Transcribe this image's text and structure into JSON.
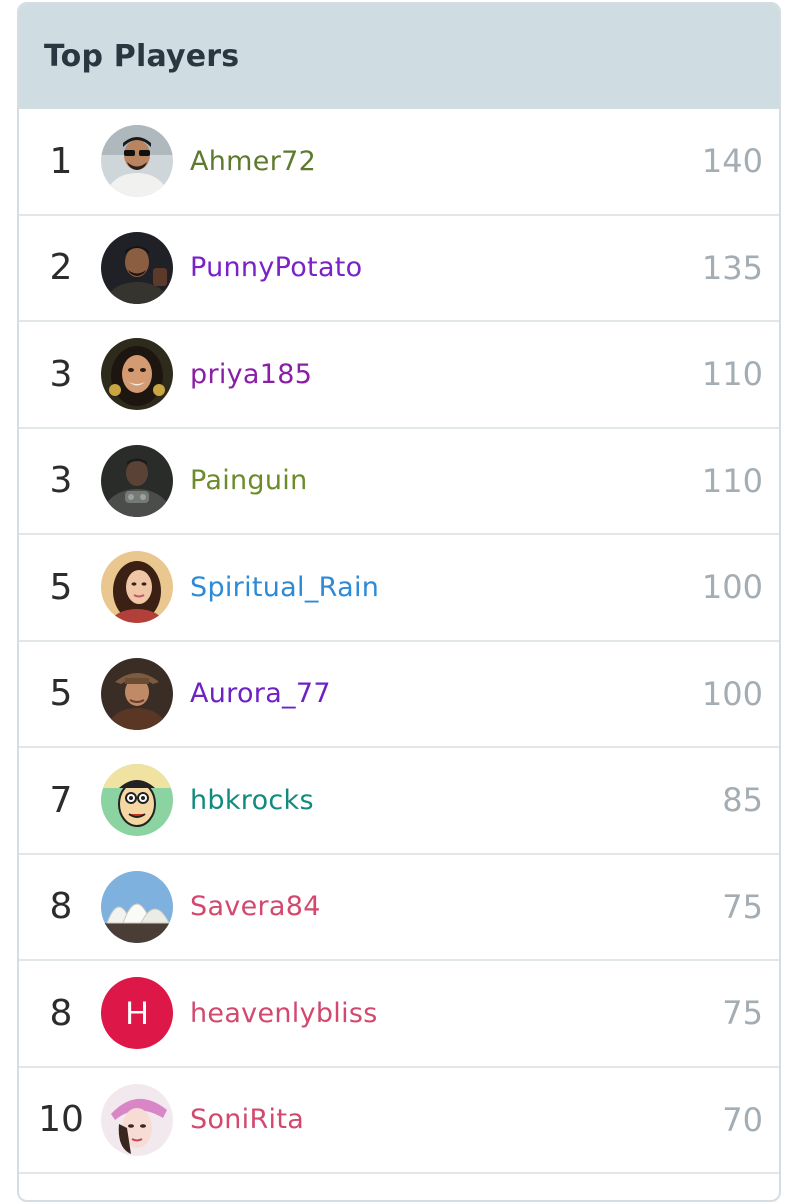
{
  "panel": {
    "title": "Top Players"
  },
  "players": [
    {
      "rank": "1",
      "name": "Ahmer72",
      "score": "140",
      "name_color": "#5e7a2d",
      "avatar_icon": "avatar-photo"
    },
    {
      "rank": "2",
      "name": "PunnyPotato",
      "score": "135",
      "name_color": "#7a22c8",
      "avatar_icon": "avatar-photo"
    },
    {
      "rank": "3",
      "name": "priya185",
      "score": "110",
      "name_color": "#8a1fa7",
      "avatar_icon": "avatar-photo"
    },
    {
      "rank": "3",
      "name": "Painguin",
      "score": "110",
      "name_color": "#6c8c2a",
      "avatar_icon": "avatar-photo"
    },
    {
      "rank": "5",
      "name": "Spiritual_Rain",
      "score": "100",
      "name_color": "#2c8ad6",
      "avatar_icon": "avatar-photo"
    },
    {
      "rank": "5",
      "name": "Aurora_77",
      "score": "100",
      "name_color": "#6e22c4",
      "avatar_icon": "avatar-photo"
    },
    {
      "rank": "7",
      "name": "hbkrocks",
      "score": "85",
      "name_color": "#118a80",
      "avatar_icon": "avatar-cartoon"
    },
    {
      "rank": "8",
      "name": "Savera84",
      "score": "75",
      "name_color": "#d2486e",
      "avatar_icon": "avatar-photo"
    },
    {
      "rank": "8",
      "name": "heavenlybliss",
      "score": "75",
      "name_color": "#d2486e",
      "avatar_icon": "avatar-letter",
      "avatar_letter": "H",
      "avatar_bg": "#dd1748"
    },
    {
      "rank": "10",
      "name": "SoniRita",
      "score": "70",
      "name_color": "#d2486e",
      "avatar_icon": "avatar-photo"
    }
  ]
}
